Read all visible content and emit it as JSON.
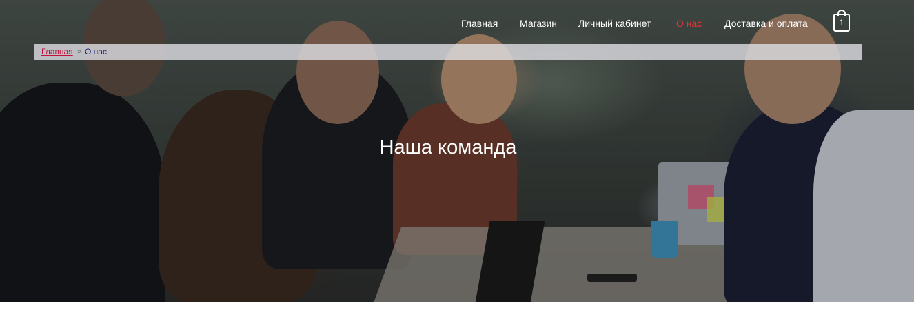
{
  "nav": {
    "items": [
      {
        "label": "Главная"
      },
      {
        "label": "Магазин"
      },
      {
        "label": "Личный кабинет"
      },
      {
        "label": "О нас"
      },
      {
        "label": "Доставка и оплата"
      }
    ],
    "active_index": 3,
    "active_color": "#e03838",
    "cart": {
      "icon": "shopping-bag-icon",
      "count": "1"
    }
  },
  "breadcrumb": {
    "home_label": "Главная",
    "separator": "»",
    "current_label": "О нас"
  },
  "hero": {
    "title": "Наша команда"
  }
}
